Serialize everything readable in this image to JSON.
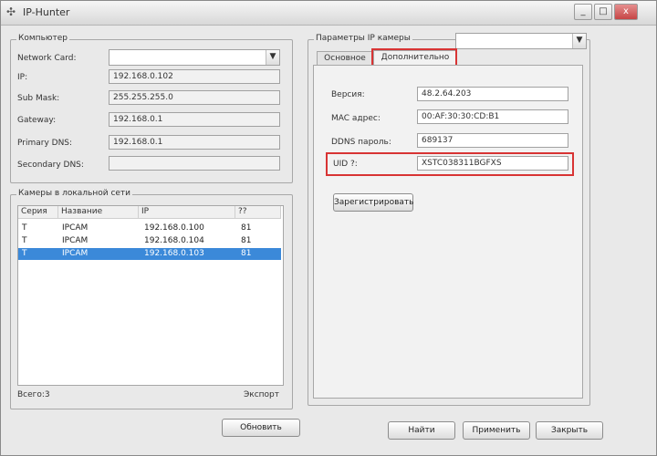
{
  "window": {
    "title": "IP-Hunter",
    "buttons": {
      "minimize": "_",
      "maximize": "□",
      "close": "x"
    }
  },
  "computer": {
    "legend": "Компьютер",
    "rows": [
      {
        "label": "Network Card:",
        "value": ""
      },
      {
        "label": "IP:",
        "value": "192.168.0.102"
      },
      {
        "label": "Sub Mask:",
        "value": "255.255.255.0"
      },
      {
        "label": "Gateway:",
        "value": "192.168.0.1"
      },
      {
        "label": "Primary DNS:",
        "value": "192.168.0.1"
      },
      {
        "label": "Secondary DNS:",
        "value": ""
      }
    ]
  },
  "cameras": {
    "legend": "Камеры в локальной сети",
    "headers": [
      "Серия",
      "Название",
      "IP",
      "??"
    ],
    "rows": [
      [
        "T",
        "IPCAM",
        "192.168.0.100",
        "81"
      ],
      [
        "T",
        "IPCAM",
        "192.168.0.104",
        "81"
      ],
      [
        "T",
        "IPCAM",
        "192.168.0.103",
        "81"
      ]
    ],
    "selected_row": 2,
    "total_label": "Всего:3",
    "export_label": "Экспорт"
  },
  "params": {
    "legend": "Параметры IP камеры",
    "combo_value": "",
    "tabs": [
      "Основное",
      "Дополнительно"
    ],
    "active_tab": 1,
    "rows": [
      {
        "label": "Версия:",
        "value": "48.2.64.203"
      },
      {
        "label": "MAC адрес:",
        "value": "00:AF:30:30:CD:B1"
      },
      {
        "label": "DDNS пароль:",
        "value": "689137"
      },
      {
        "label": "UID ?:",
        "value": "XSTC038311BGFXS"
      }
    ],
    "register_button": "Зарегистрировать"
  },
  "buttons": {
    "refresh": "Обновить",
    "find": "Найти",
    "apply": "Применить",
    "close": "Закрыть"
  },
  "colors": {
    "selection": "#3b89d9",
    "highlight": "#d83434"
  }
}
